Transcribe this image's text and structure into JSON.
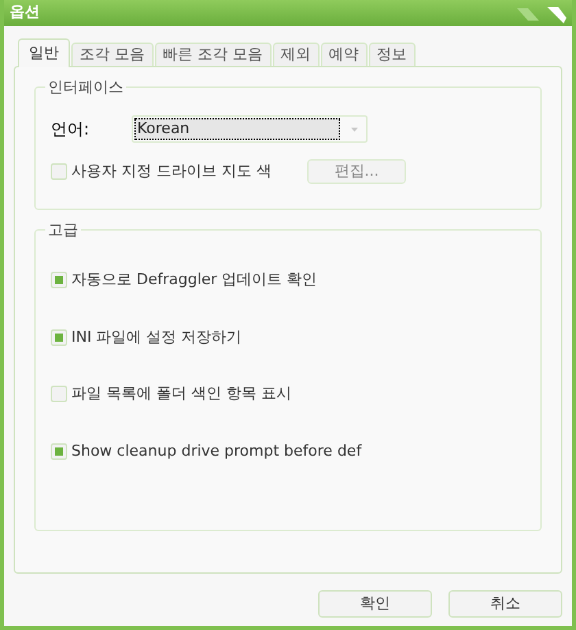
{
  "window": {
    "title": "옵션"
  },
  "tabs": [
    {
      "label": "일반",
      "selected": true
    },
    {
      "label": "조각 모음",
      "selected": false
    },
    {
      "label": "빠른 조각 모음",
      "selected": false
    },
    {
      "label": "제외",
      "selected": false
    },
    {
      "label": "예약",
      "selected": false
    },
    {
      "label": "정보",
      "selected": false
    }
  ],
  "interface_group": {
    "title": "인터페이스",
    "language_label": "언어:",
    "language_value": "Korean",
    "custom_colors": {
      "label": "사용자 지정 드라이브 지도 색",
      "checked": false
    },
    "edit_button": "편집..."
  },
  "advanced_group": {
    "title": "고급",
    "options": [
      {
        "label": "자동으로 Defraggler 업데이트 확인",
        "checked": true
      },
      {
        "label": "INI 파일에 설정 저장하기",
        "checked": true
      },
      {
        "label": "파일 목록에 폴더 색인 항목 표시",
        "checked": false
      },
      {
        "label": "Show cleanup drive prompt before def",
        "checked": true
      }
    ]
  },
  "buttons": [
    {
      "label": "확인"
    },
    {
      "label": "취소"
    }
  ]
}
